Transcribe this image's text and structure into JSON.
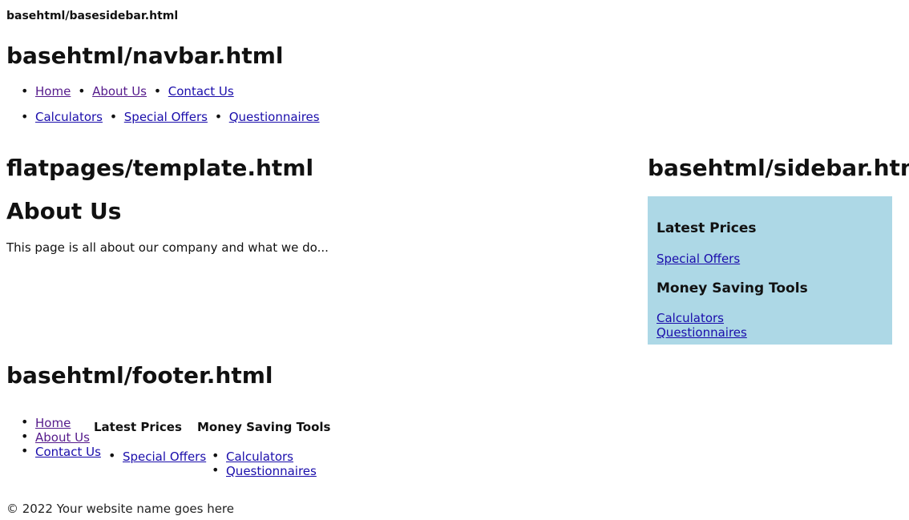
{
  "basesidebar_label": "basehtml/basesidebar.html",
  "navbar": {
    "label": "basehtml/navbar.html",
    "row1": [
      "Home",
      "About Us",
      "Contact Us"
    ],
    "row2": [
      "Calculators",
      "Special Offers",
      "Questionnaires"
    ]
  },
  "content": {
    "template_label": "flatpages/template.html",
    "title": "About Us",
    "body": "This page is all about our company and what we do..."
  },
  "sidebar": {
    "label": "basehtml/sidebar.html",
    "section1_heading": "Latest Prices",
    "section1_link": "Special Offers",
    "section2_heading": "Money Saving Tools",
    "section2_links": [
      "Calculators",
      "Questionnaires"
    ],
    "background": "#add8e6"
  },
  "footer": {
    "label": "basehtml/footer.html",
    "links": [
      "Home",
      "About Us",
      "Contact Us"
    ],
    "latest_heading": "Latest Prices",
    "latest_links": [
      "Special Offers"
    ],
    "tools_heading": "Money Saving Tools",
    "tools_links": [
      "Calculators",
      "Questionnaires"
    ],
    "copyright": "© 2022 Your website name goes here"
  }
}
